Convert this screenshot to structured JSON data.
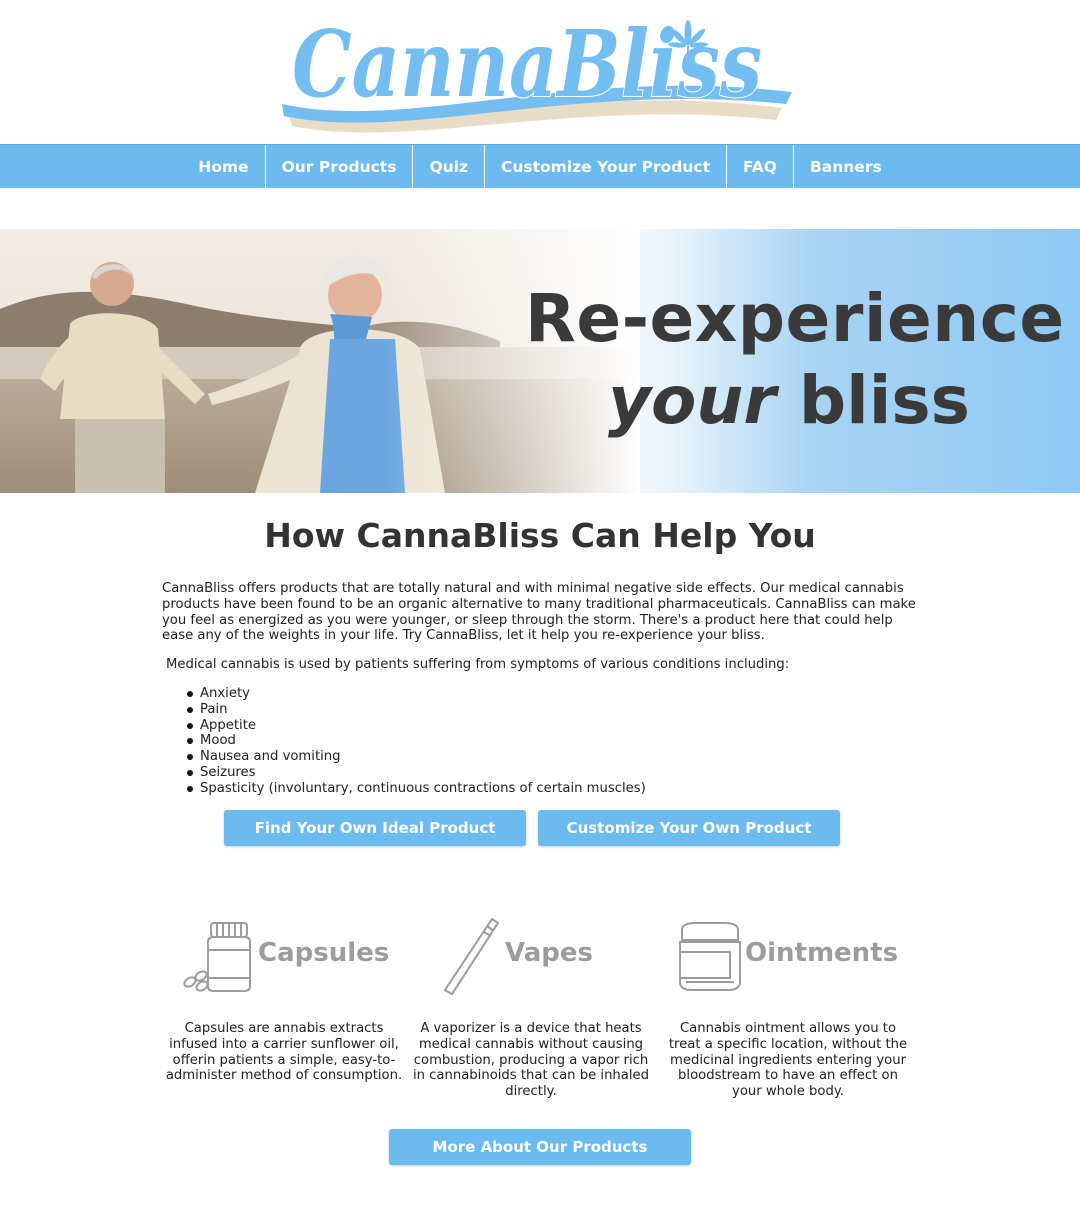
{
  "logo": {
    "text": "CannaBliss",
    "icon": "cannabis-leaf-icon"
  },
  "nav": {
    "items": [
      {
        "label": "Home"
      },
      {
        "label": "Our Products"
      },
      {
        "label": "Quiz"
      },
      {
        "label": "Customize Your Product"
      },
      {
        "label": "FAQ"
      },
      {
        "label": "Banners"
      }
    ]
  },
  "hero": {
    "line1": "Re-experience",
    "line2_emph": "your",
    "line2_rest": " bliss"
  },
  "main": {
    "heading": "How CannaBliss Can Help You",
    "intro": "CannaBliss offers products that are totally natural and with minimal negative side effects. Our medical cannabis products have been found to be an organic alternative to many traditional pharmaceuticals. CannaBliss can make you feel as energized as you were younger, or sleep through the storm. There's a product here that could help ease any of the weights in your life. Try CannaBliss, let it help you re-experience your bliss.",
    "conditions_lead": "Medical cannabis is used by patients suffering from symptoms of various conditions including:",
    "conditions": [
      "Anxiety",
      "Pain",
      "Appetite",
      "Mood",
      "Nausea and vomiting",
      "Seizures",
      "Spasticity (involuntary, continuous contractions of certain muscles)"
    ],
    "btn_ideal": "Find Your Own Ideal Product",
    "btn_customize": "Customize Your Own Product"
  },
  "products": [
    {
      "title": "Capsules",
      "icon": "capsules-bottle-icon",
      "desc": "Capsules are annabis extracts infused into a carrier sunflower oil, offerin patients a simple, easy-to-administer method of consumption."
    },
    {
      "title": "Vapes",
      "icon": "vape-pen-icon",
      "desc": "A vaporizer is a device that heats medical cannabis without causing combustion, producing a vapor rich in cannabinoids that can be inhaled directly."
    },
    {
      "title": "Ointments",
      "icon": "ointment-jar-icon",
      "desc": "Cannabis ointment allows you to treat a specific location, without the medicinal ingredients entering your bloodstream to have an effect on your whole body."
    }
  ],
  "btn_more": "More About Our Products",
  "colors": {
    "brand_blue": "#6bbaf0",
    "logo_blue": "#73bdf1",
    "logo_swoosh_tan": "#e8dcc6",
    "icon_gray": "#9c9c9c"
  }
}
